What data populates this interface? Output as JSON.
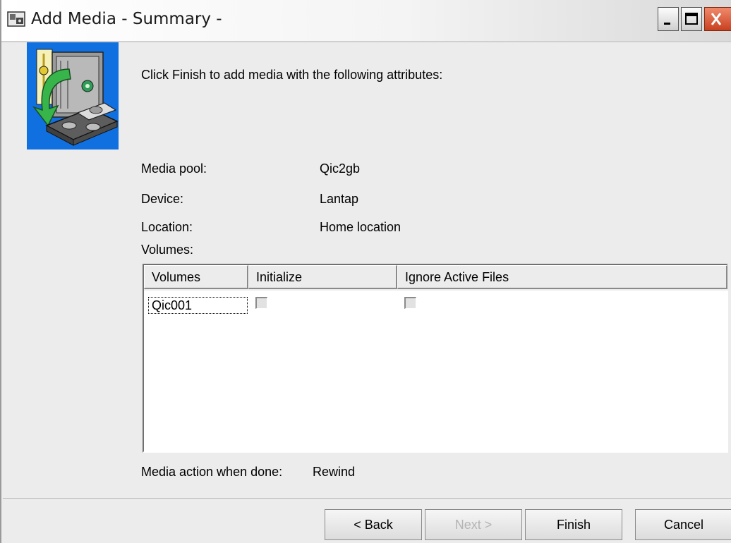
{
  "window": {
    "title": "Add Media - Summary -"
  },
  "instruction": "Click Finish to add media with the following attributes:",
  "fields": {
    "media_pool": {
      "label": "Media pool:",
      "value": "Qic2gb"
    },
    "device": {
      "label": "Device:",
      "value": "Lantap"
    },
    "location": {
      "label": "Location:",
      "value": "Home location"
    },
    "volumes_label": "Volumes:"
  },
  "table": {
    "columns": [
      "Volumes",
      "Initialize",
      "Ignore Active Files"
    ],
    "rows": [
      {
        "volume": "Qic001",
        "initialize": false,
        "ignore_active_files": false
      }
    ]
  },
  "media_action": {
    "label": "Media action when done:",
    "value": "Rewind"
  },
  "buttons": {
    "back": "< Back",
    "next": "Next >",
    "finish": "Finish",
    "cancel": "Cancel"
  }
}
